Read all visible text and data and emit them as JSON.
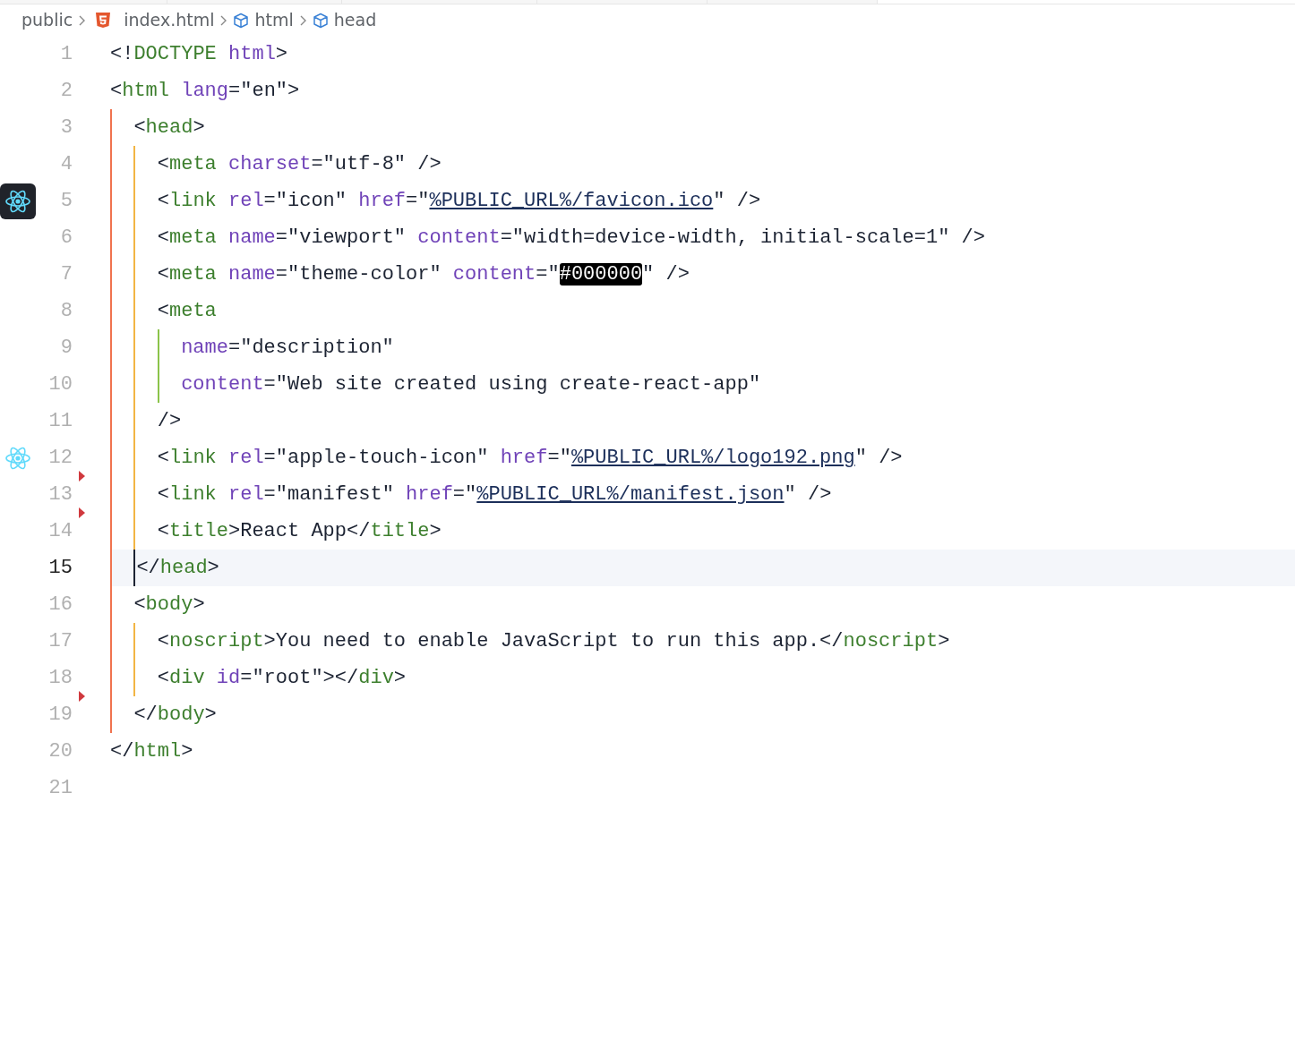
{
  "breadcrumb": [
    {
      "kind": "folder",
      "label": "public"
    },
    {
      "kind": "file",
      "label": "index.html"
    },
    {
      "kind": "element",
      "label": "html"
    },
    {
      "kind": "element",
      "label": "head"
    }
  ],
  "editor": {
    "lines": [
      {
        "number": "1",
        "selected": false,
        "tokens": [
          {
            "kind": "plain",
            "text": "<!"
          },
          {
            "kind": "tag",
            "text": "DOCTYPE"
          },
          {
            "kind": "attr",
            "text": " html"
          },
          {
            "kind": "plain",
            "text": ">"
          }
        ]
      },
      {
        "number": "2",
        "selected": false,
        "tokens": [
          {
            "kind": "plain",
            "text": "<"
          },
          {
            "kind": "tag",
            "text": "html"
          },
          {
            "kind": "attr",
            "text": " lang"
          },
          {
            "kind": "plain",
            "text": "=\"en\">"
          }
        ]
      },
      {
        "number": "3",
        "selected": false,
        "tokens": [
          {
            "kind": "plain",
            "text": "  <"
          },
          {
            "kind": "tag",
            "text": "head"
          },
          {
            "kind": "plain",
            "text": ">"
          }
        ]
      },
      {
        "number": "4",
        "selected": false,
        "tokens": [
          {
            "kind": "plain",
            "text": "    <"
          },
          {
            "kind": "tag",
            "text": "meta"
          },
          {
            "kind": "attr",
            "text": " charset"
          },
          {
            "kind": "plain",
            "text": "=\"utf-8\" />"
          }
        ]
      },
      {
        "number": "5",
        "selected": false,
        "gutter_icon": {
          "kind": "atom",
          "boxed": true
        },
        "tokens": [
          {
            "kind": "plain",
            "text": "    <"
          },
          {
            "kind": "tag",
            "text": "link"
          },
          {
            "kind": "attr",
            "text": " rel"
          },
          {
            "kind": "plain",
            "text": "=\"icon\" "
          },
          {
            "kind": "attr",
            "text": "href"
          },
          {
            "kind": "plain",
            "text": "=\""
          },
          {
            "kind": "link",
            "text": "%PUBLIC_URL%/favicon.ico"
          },
          {
            "kind": "plain",
            "text": "\" />"
          }
        ]
      },
      {
        "number": "6",
        "selected": false,
        "tokens": [
          {
            "kind": "plain",
            "text": "    <"
          },
          {
            "kind": "tag",
            "text": "meta"
          },
          {
            "kind": "attr",
            "text": " name"
          },
          {
            "kind": "plain",
            "text": "=\"viewport\" "
          },
          {
            "kind": "attr",
            "text": "content"
          },
          {
            "kind": "plain",
            "text": "=\"width=device-width, initial-scale=1\" />"
          }
        ]
      },
      {
        "number": "7",
        "selected": false,
        "tokens": [
          {
            "kind": "plain",
            "text": "    <"
          },
          {
            "kind": "tag",
            "text": "meta"
          },
          {
            "kind": "attr",
            "text": " name"
          },
          {
            "kind": "plain",
            "text": "=\"theme-color\" "
          },
          {
            "kind": "attr",
            "text": "content"
          },
          {
            "kind": "plain",
            "text": "=\""
          },
          {
            "kind": "highlight",
            "text": "#000000"
          },
          {
            "kind": "plain",
            "text": "\" />"
          }
        ]
      },
      {
        "number": "8",
        "selected": false,
        "tokens": [
          {
            "kind": "plain",
            "text": "    <"
          },
          {
            "kind": "tag",
            "text": "meta"
          }
        ]
      },
      {
        "number": "9",
        "selected": false,
        "tokens": [
          {
            "kind": "attr",
            "text": "      name"
          },
          {
            "kind": "plain",
            "text": "=\"description\""
          }
        ]
      },
      {
        "number": "10",
        "selected": false,
        "tokens": [
          {
            "kind": "attr",
            "text": "      content"
          },
          {
            "kind": "plain",
            "text": "=\"Web site created using create-react-app\""
          }
        ]
      },
      {
        "number": "11",
        "selected": false,
        "tokens": [
          {
            "kind": "plain",
            "text": "    />"
          }
        ]
      },
      {
        "number": "12",
        "selected": false,
        "gutter_icon": {
          "kind": "atom",
          "boxed": false
        },
        "tokens": [
          {
            "kind": "plain",
            "text": "    <"
          },
          {
            "kind": "tag",
            "text": "link"
          },
          {
            "kind": "attr",
            "text": " rel"
          },
          {
            "kind": "plain",
            "text": "=\"apple-touch-icon\" "
          },
          {
            "kind": "attr",
            "text": "href"
          },
          {
            "kind": "plain",
            "text": "=\""
          },
          {
            "kind": "link",
            "text": "%PUBLIC_URL%/logo192.png"
          },
          {
            "kind": "plain",
            "text": "\" />"
          }
        ]
      },
      {
        "number": "13",
        "selected": false,
        "change_marker": true,
        "tokens": [
          {
            "kind": "plain",
            "text": "    <"
          },
          {
            "kind": "tag",
            "text": "link"
          },
          {
            "kind": "attr",
            "text": " rel"
          },
          {
            "kind": "plain",
            "text": "=\"manifest\" "
          },
          {
            "kind": "attr",
            "text": "href"
          },
          {
            "kind": "plain",
            "text": "=\""
          },
          {
            "kind": "link",
            "text": "%PUBLIC_URL%/manifest.json"
          },
          {
            "kind": "plain",
            "text": "\" />"
          }
        ]
      },
      {
        "number": "14",
        "selected": false,
        "change_marker": true,
        "tokens": [
          {
            "kind": "plain",
            "text": "    <"
          },
          {
            "kind": "tag",
            "text": "title"
          },
          {
            "kind": "plain",
            "text": ">React App</"
          },
          {
            "kind": "tag",
            "text": "title"
          },
          {
            "kind": "plain",
            "text": ">"
          }
        ]
      },
      {
        "number": "15",
        "selected": true,
        "tokens": [
          {
            "kind": "plain",
            "text": "  </"
          },
          {
            "kind": "tag",
            "text": "head"
          },
          {
            "kind": "plain",
            "text": ">"
          }
        ]
      },
      {
        "number": "16",
        "selected": false,
        "tokens": [
          {
            "kind": "plain",
            "text": "  <"
          },
          {
            "kind": "tag",
            "text": "body"
          },
          {
            "kind": "plain",
            "text": ">"
          }
        ]
      },
      {
        "number": "17",
        "selected": false,
        "tokens": [
          {
            "kind": "plain",
            "text": "    <"
          },
          {
            "kind": "tag",
            "text": "noscript"
          },
          {
            "kind": "plain",
            "text": ">You need to enable JavaScript to run this app.</"
          },
          {
            "kind": "tag",
            "text": "noscript"
          },
          {
            "kind": "plain",
            "text": ">"
          }
        ]
      },
      {
        "number": "18",
        "selected": false,
        "tokens": [
          {
            "kind": "plain",
            "text": "    <"
          },
          {
            "kind": "tag",
            "text": "div"
          },
          {
            "kind": "attr",
            "text": " id"
          },
          {
            "kind": "plain",
            "text": "=\"root\"></"
          },
          {
            "kind": "tag",
            "text": "div"
          },
          {
            "kind": "plain",
            "text": ">"
          }
        ]
      },
      {
        "number": "19",
        "selected": false,
        "change_marker": true,
        "tokens": [
          {
            "kind": "plain",
            "text": "  </"
          },
          {
            "kind": "tag",
            "text": "body"
          },
          {
            "kind": "plain",
            "text": ">"
          }
        ]
      },
      {
        "number": "20",
        "selected": false,
        "tokens": [
          {
            "kind": "plain",
            "text": "</"
          },
          {
            "kind": "tag",
            "text": "html"
          },
          {
            "kind": "plain",
            "text": ">"
          }
        ]
      },
      {
        "number": "21",
        "selected": false
      }
    ]
  }
}
